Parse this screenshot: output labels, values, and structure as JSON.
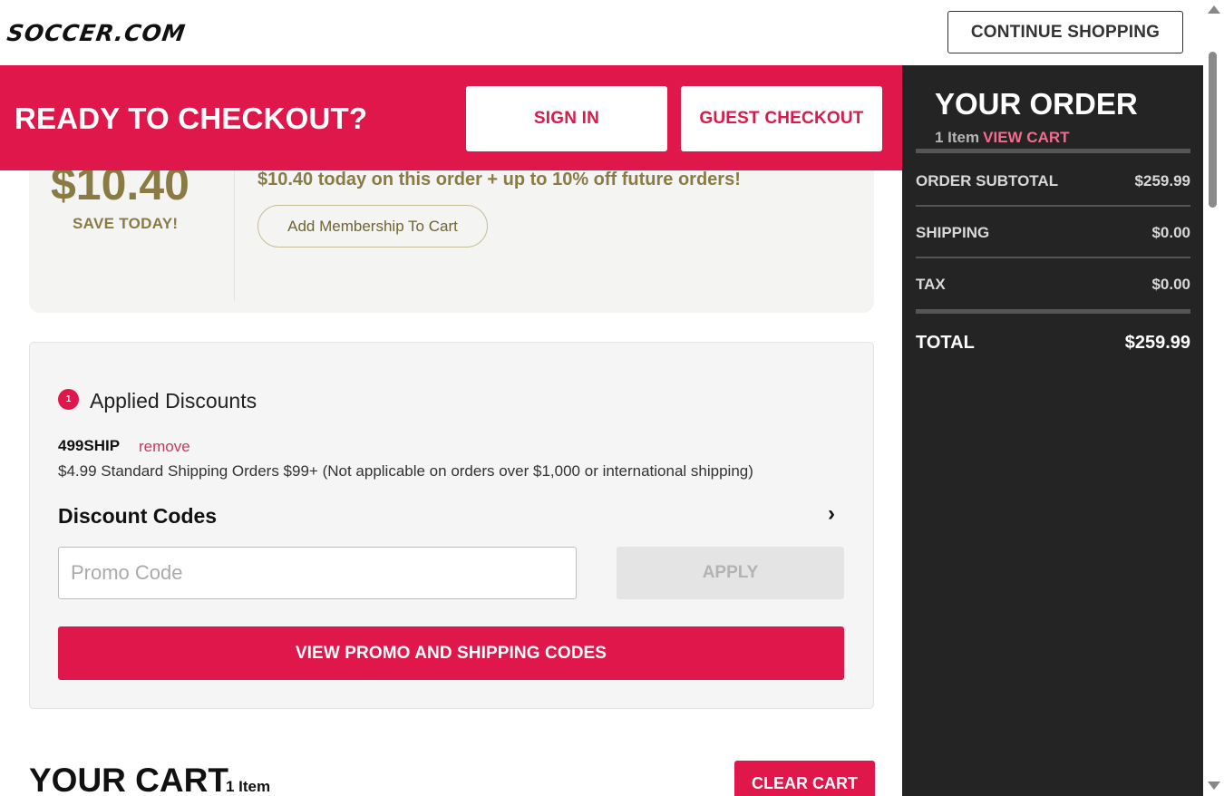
{
  "header": {
    "logo": "SOCCER.COM",
    "continue_label": "CONTINUE SHOPPING"
  },
  "checkout_banner": {
    "title": "READY TO CHECKOUT?",
    "sign_in_label": "SIGN IN",
    "guest_label": "GUEST CHECKOUT"
  },
  "membership": {
    "amount": "$10.40",
    "save_today": "SAVE TODAY!",
    "savings_text": "$10.40 today on this order + up to 10% off future orders!",
    "add_label": "Add Membership To Cart"
  },
  "discounts": {
    "count": "1",
    "title": "Applied Discounts",
    "code": "499SHIP",
    "remove_label": "remove",
    "description": "$4.99 Standard Shipping Orders $99+ (Not applicable on orders over $1,000 or international shipping)",
    "codes_title": "Discount Codes",
    "chevron": "›",
    "promo_placeholder": "Promo Code",
    "apply_label": "APPLY",
    "view_codes_label": "VIEW PROMO AND SHIPPING CODES"
  },
  "cart": {
    "title": "YOUR CART",
    "count": "1 Item",
    "clear_label": "CLEAR CART"
  },
  "order": {
    "title": "YOUR ORDER",
    "count": "1 Item",
    "view_cart_label": "VIEW CART",
    "subtotal_label": "ORDER SUBTOTAL",
    "subtotal_value": "$259.99",
    "shipping_label": "SHIPPING",
    "shipping_value": "$0.00",
    "tax_label": "TAX",
    "tax_value": "$0.00",
    "total_label": "TOTAL",
    "total_value": "$259.99"
  },
  "colors": {
    "brand_red": "#e0174b",
    "gold": "#8a7b45",
    "panel_dark": "#242424"
  }
}
